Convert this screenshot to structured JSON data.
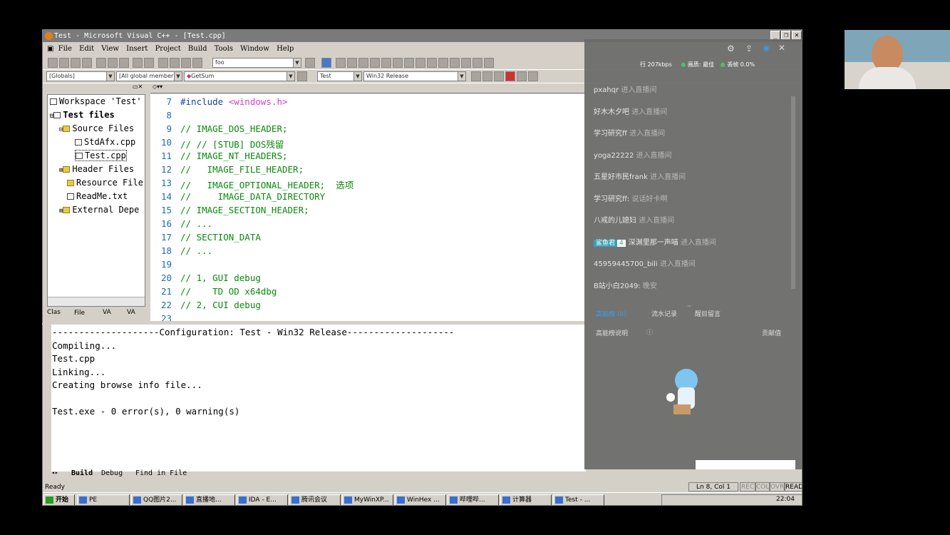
{
  "window": {
    "title": "Test - Microsoft Visual C++ - [Test.cpp]"
  },
  "menu": [
    "File",
    "Edit",
    "View",
    "Insert",
    "Project",
    "Build",
    "Tools",
    "Window",
    "Help"
  ],
  "toolbar": {
    "find_combo": "foo",
    "scope_combo": "[Globals]",
    "members_combo": "[All global member",
    "function_combo": "GetSum",
    "project_combo": "Test",
    "config_combo": "Win32 Release"
  },
  "workspace": {
    "items": [
      {
        "label": "Workspace 'Test'",
        "icon": "workspace-icon"
      },
      {
        "label": "Test files",
        "icon": "project-icon"
      },
      {
        "label": "Source Files",
        "icon": "folder-icon"
      },
      {
        "label": "StdAfx.cpp",
        "icon": "file-icon"
      },
      {
        "label": "Test.cpp",
        "icon": "file-icon"
      },
      {
        "label": "Header Files",
        "icon": "folder-icon"
      },
      {
        "label": "Resource File",
        "icon": "folder-icon"
      },
      {
        "label": "ReadMe.txt",
        "icon": "file-icon"
      },
      {
        "label": "External Depe",
        "icon": "folder-icon"
      }
    ],
    "tabs": [
      "Clas",
      "File",
      "VA",
      "VA"
    ]
  },
  "editor": {
    "lines": [
      {
        "num": "7",
        "text": "#include <windows.h>"
      },
      {
        "num": "8",
        "text": ""
      },
      {
        "num": "9",
        "text": "// IMAGE_DOS_HEADER;"
      },
      {
        "num": "10",
        "text": "// // [STUB] DOS残留"
      },
      {
        "num": "11",
        "text": "// IMAGE_NT_HEADERS;"
      },
      {
        "num": "12",
        "text": "//   IMAGE_FILE_HEADER;"
      },
      {
        "num": "13",
        "text": "//   IMAGE_OPTIONAL_HEADER;  选项"
      },
      {
        "num": "14",
        "text": "//     IMAGE_DATA_DIRECTORY"
      },
      {
        "num": "15",
        "text": "// IMAGE_SECTION_HEADER;"
      },
      {
        "num": "16",
        "text": "// ..."
      },
      {
        "num": "17",
        "text": "// SECTION_DATA"
      },
      {
        "num": "18",
        "text": "// ..."
      },
      {
        "num": "19",
        "text": ""
      },
      {
        "num": "20",
        "text": "// 1, GUI debug"
      },
      {
        "num": "21",
        "text": "//    TD OD x64dbg"
      },
      {
        "num": "22",
        "text": "// 2, CUI debug"
      },
      {
        "num": "23",
        "text": ""
      }
    ]
  },
  "output": {
    "lines": [
      "--------------------Configuration: Test - Win32 Release--------------------",
      "Compiling...",
      "Test.cpp",
      "Linking...",
      "Creating browse info file...",
      "",
      "Test.exe - 0 error(s), 0 warning(s)"
    ],
    "tabs": [
      "Build",
      "Debug",
      "Find in File"
    ]
  },
  "stream": {
    "stats": {
      "bitrate": "行 207kbps",
      "quality": "画质: 最佳",
      "drop": "丢帧 0.0%"
    },
    "chat": [
      {
        "user": "pxahqr",
        "msg": "进入直播间"
      },
      {
        "user": "好木木夕吧",
        "msg": "进入直播间"
      },
      {
        "user": "学习研究ff",
        "msg": "进入直播间"
      },
      {
        "user": "yoga22222",
        "msg": "进入直播间"
      },
      {
        "user": "五星好市民frank",
        "msg": "进入直播间"
      },
      {
        "user": "学习研究ff:",
        "msg": "说话好卡啊"
      },
      {
        "user": "八戒的儿媳妇",
        "msg": "进入直播间"
      },
      {
        "user": "深渊里那一声喵",
        "msg": "进入直播间",
        "badge": "鲨鱼君",
        "level": "4"
      },
      {
        "user": "45959445700_bili",
        "msg": "进入直播间"
      },
      {
        "user": "B站小白2049:",
        "msg": "晚安"
      }
    ],
    "tabs": [
      "高能榜 (0)",
      "流水记录",
      "醒目留言"
    ],
    "rank_label": "高能榜说明",
    "contribution": "贡献值"
  },
  "status": {
    "ready": "Ready",
    "position": "Ln 8, Col 1",
    "flags": [
      "REC",
      "COL",
      "OVR",
      "READ"
    ]
  },
  "taskbar": {
    "start": "开始",
    "tasks": [
      "PE",
      "QQ图片2...",
      "直播地...",
      "IDA - E...",
      "腾讯会议",
      "MyWinXP...",
      "WinHex ...",
      "哔哩哔...",
      "计算器",
      "Test - ..."
    ],
    "clock": "22:04"
  }
}
